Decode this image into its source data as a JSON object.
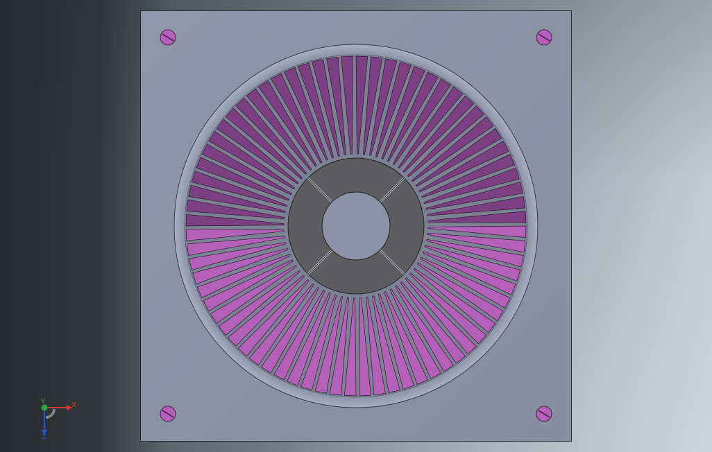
{
  "viewport": {
    "model": {
      "plate_color": "#8c93a6",
      "recess_color": "#7b8194",
      "fin_color": "#b45fb8",
      "fin_dark_color": "#7c3f82",
      "hub_color": "#5d5d5f",
      "bore_color": "#8c93a6",
      "screw_color": "#b85fbc",
      "fin_count": 72
    },
    "triad": {
      "x_label": "X",
      "y_label": "Y",
      "z_label": "Z",
      "x_color": "#d83a2e",
      "y_color": "#2fa84a",
      "z_color": "#2e4fd0"
    }
  }
}
